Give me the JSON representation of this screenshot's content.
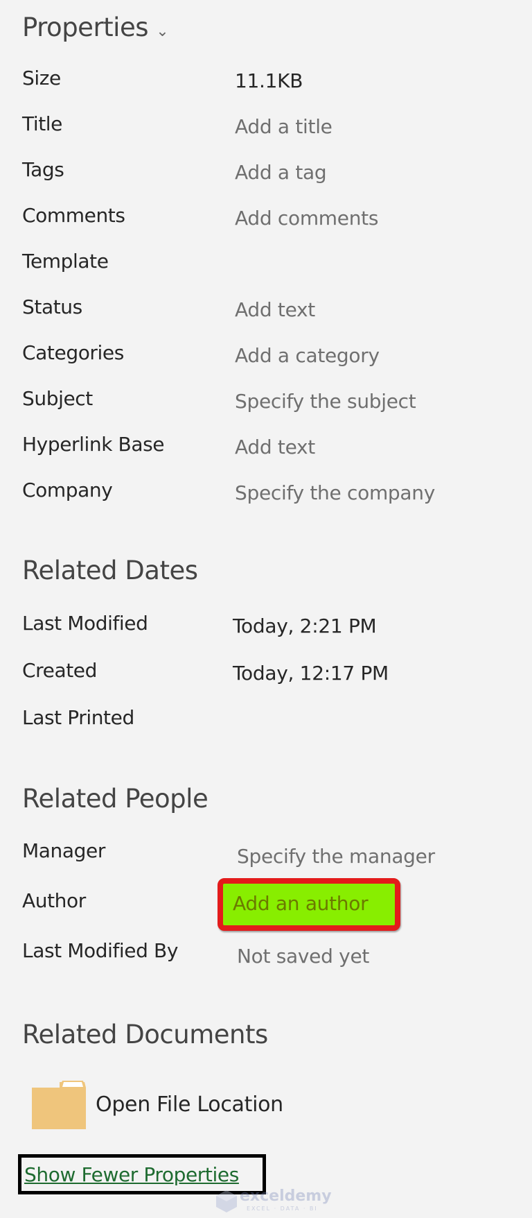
{
  "properties": {
    "heading": "Properties",
    "chevron_icon": "chevron-down-icon",
    "rows": [
      {
        "label": "Size",
        "value": "11.1KB",
        "editable": false
      },
      {
        "label": "Title",
        "value": "Add a title",
        "editable": true
      },
      {
        "label": "Tags",
        "value": "Add a tag",
        "editable": true
      },
      {
        "label": "Comments",
        "value": "Add comments",
        "editable": true
      },
      {
        "label": "Template",
        "value": "",
        "editable": false
      },
      {
        "label": "Status",
        "value": "Add text",
        "editable": true
      },
      {
        "label": "Categories",
        "value": "Add a category",
        "editable": true
      },
      {
        "label": "Subject",
        "value": "Specify the subject",
        "editable": true
      },
      {
        "label": "Hyperlink Base",
        "value": "Add text",
        "editable": true
      },
      {
        "label": "Company",
        "value": "Specify the company",
        "editable": true
      }
    ]
  },
  "related_dates": {
    "heading": "Related Dates",
    "rows": [
      {
        "label": "Last Modified",
        "value": "Today, 2:21 PM"
      },
      {
        "label": "Created",
        "value": "Today, 12:17 PM"
      },
      {
        "label": "Last Printed",
        "value": ""
      }
    ]
  },
  "related_people": {
    "heading": "Related People",
    "rows": [
      {
        "label": "Manager",
        "value": "Specify the manager"
      },
      {
        "label": "Author",
        "value": "Add an author"
      },
      {
        "label": "Last Modified By",
        "value": "Not saved yet"
      }
    ],
    "highlight_color": "#88ee00",
    "highlight_border": "#e31b1b"
  },
  "related_documents": {
    "heading": "Related Documents",
    "open_file_location": "Open File Location",
    "folder_icon": "folder-icon"
  },
  "show_fewer_properties": "Show Fewer Properties",
  "watermark": {
    "text": "exceldemy",
    "sub": "EXCEL · DATA · BI"
  }
}
